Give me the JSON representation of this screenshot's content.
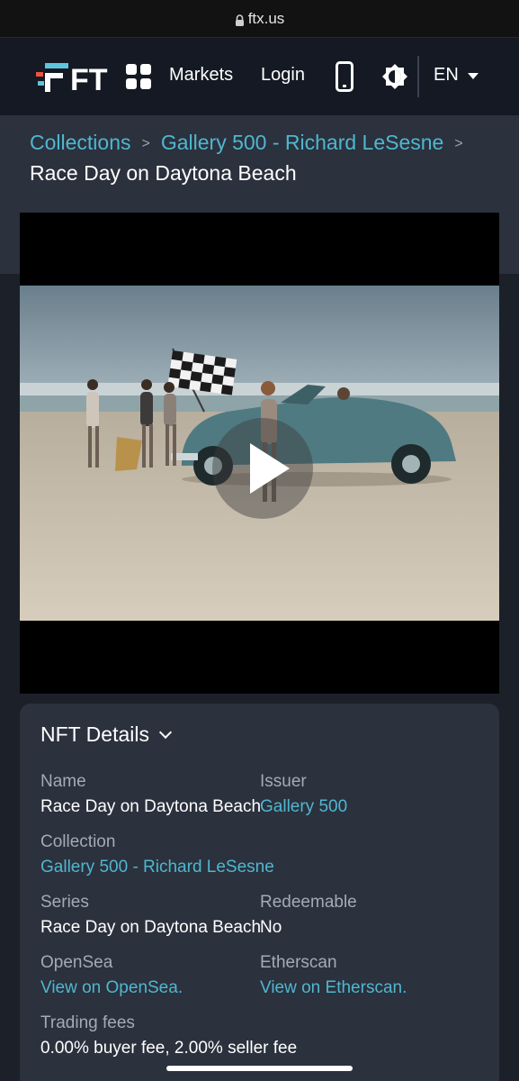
{
  "browser": {
    "url": "ftx.us"
  },
  "nav": {
    "logo_text": "FT",
    "markets_label": "Markets",
    "login_label": "Login",
    "language": "EN"
  },
  "breadcrumb": {
    "items": [
      "Collections",
      "Gallery 500 - Richard LeSesne"
    ],
    "separator": ">",
    "current": "Race Day on Daytona Beach"
  },
  "details": {
    "title": "NFT Details",
    "name_label": "Name",
    "name_value": "Race Day on Daytona Beach",
    "issuer_label": "Issuer",
    "issuer_value": "Gallery 500",
    "collection_label": "Collection",
    "collection_value": "Gallery 500 - Richard LeSesne",
    "series_label": "Series",
    "series_value": "Race Day on Daytona Beach",
    "redeemable_label": "Redeemable",
    "redeemable_value": "No",
    "opensea_label": "OpenSea",
    "opensea_value": "View on OpenSea.",
    "etherscan_label": "Etherscan",
    "etherscan_value": "View on Etherscan.",
    "fees_label": "Trading fees",
    "fees_value": "0.00% buyer fee, 2.00% seller fee"
  },
  "colors": {
    "accent": "#4fb7cf",
    "background": "#1b2029",
    "card": "#2b313d",
    "nav": "#141923"
  }
}
